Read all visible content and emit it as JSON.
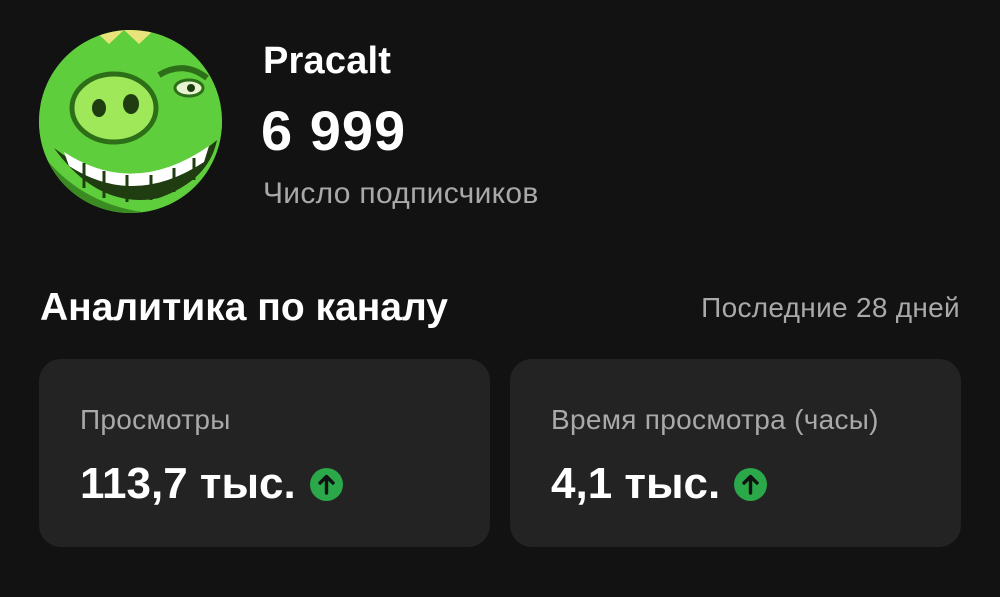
{
  "channel": {
    "name": "Pracalt",
    "subscriber_count": "6 999",
    "subscriber_label": "Число подписчиков"
  },
  "analytics": {
    "title": "Аналитика по каналу",
    "period": "Последние 28 дней",
    "cards": [
      {
        "label": "Просмотры",
        "value": "113,7 тыс.",
        "trend": "up",
        "trend_icon": "arrow-up-icon"
      },
      {
        "label": "Время просмотра (часы)",
        "value": "4,1 тыс.",
        "trend": "up",
        "trend_icon": "arrow-up-icon"
      }
    ]
  },
  "colors": {
    "background": "#121212",
    "card": "#232323",
    "text_primary": "#ffffff",
    "text_secondary": "#a9a9a9",
    "trend_up": "#2ba84a",
    "avatar_green": "#5fce3c"
  }
}
